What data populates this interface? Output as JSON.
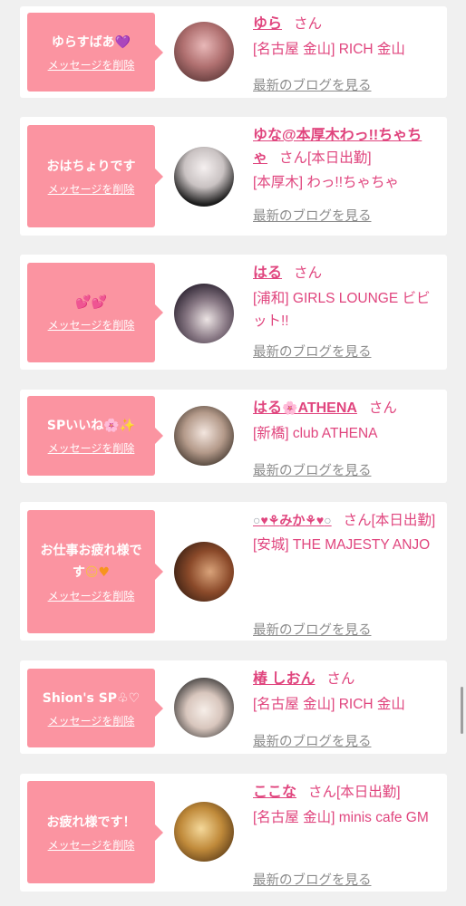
{
  "delete_label": "メッセージを削除",
  "blog_label": "最新のブログを見る",
  "san_label": "さん",
  "colors": {
    "bubble": "#fb94a1",
    "accent": "#e0457e",
    "link_gray": "#8c8c8c",
    "background": "#f0f0f0"
  },
  "cards": [
    {
      "message": "ゆらすばあ",
      "message_icon": "purple-heart",
      "name": "ゆら",
      "status": "",
      "shop": "[名古屋 金山] RICH 金山"
    },
    {
      "message": "おはちょりです",
      "name": "ゆな@本厚木わっ!!ちゃちゃ",
      "status": "[本日出勤]",
      "shop": "[本厚木] わっ!!ちゃちゃ"
    },
    {
      "message": "",
      "message_icon": "double-hearts",
      "name": "はる",
      "status": "",
      "shop": "[浦和] GIRLS LOUNGE ビビット!!"
    },
    {
      "message": "SPいいね",
      "message_icon": "blossom-sparkles",
      "name": "はる",
      "name_suffix": "ATHENA",
      "name_icon": "cherry-blossom",
      "status": "",
      "shop": "[新橋] club ATHENA"
    },
    {
      "message": "お仕事お疲れ様です",
      "message_icon": "smile-orange-heart",
      "name": "みか",
      "name_icon": "ring-heart-tulip",
      "status": "[本日出勤]",
      "shop": "[安城] THE MAJESTY ANJO"
    },
    {
      "message": "Shion's SP",
      "message_icon": "rabbit-white-heart",
      "name": "椿 しおん",
      "status": "",
      "shop": "[名古屋 金山] RICH 金山"
    },
    {
      "message": "お疲れ様です！",
      "name": "ここな",
      "status": "[本日出勤]",
      "shop": "[名古屋 金山] minis cafe GM"
    }
  ]
}
